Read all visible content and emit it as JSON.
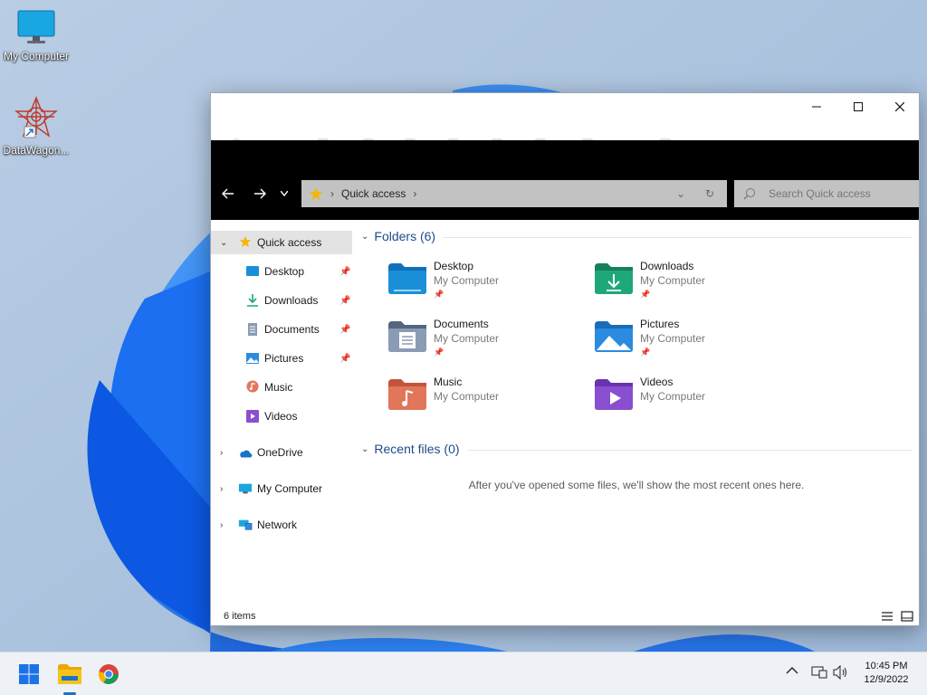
{
  "desktop": {
    "icons": [
      {
        "label": "My Computer"
      },
      {
        "label": "DataWagon..."
      }
    ]
  },
  "window": {
    "title_controls": {
      "minimize": "minimize",
      "maximize": "maximize",
      "close": "close"
    },
    "address": {
      "location": "Quick access"
    },
    "search": {
      "placeholder": "Search Quick access"
    }
  },
  "sidebar": {
    "items": [
      {
        "label": "Quick access",
        "icon": "star-icon",
        "selected": true
      },
      {
        "label": "Desktop",
        "icon": "desktop-folder-icon",
        "pinned": true
      },
      {
        "label": "Downloads",
        "icon": "downloads-icon",
        "pinned": true
      },
      {
        "label": "Documents",
        "icon": "documents-icon",
        "pinned": true
      },
      {
        "label": "Pictures",
        "icon": "pictures-icon",
        "pinned": true
      },
      {
        "label": "Music",
        "icon": "music-icon"
      },
      {
        "label": "Videos",
        "icon": "videos-icon"
      },
      {
        "label": "OneDrive",
        "icon": "onedrive-icon"
      },
      {
        "label": "My Computer",
        "icon": "computer-icon"
      },
      {
        "label": "Network",
        "icon": "network-icon"
      }
    ]
  },
  "content": {
    "folders_header": "Folders (6)",
    "folders": [
      {
        "name": "Desktop",
        "location": "My Computer",
        "pinned": true,
        "color": "#1a8fd8"
      },
      {
        "name": "Downloads",
        "location": "My Computer",
        "pinned": true,
        "color": "#1ea87a"
      },
      {
        "name": "Documents",
        "location": "My Computer",
        "pinned": true,
        "color": "#6d7f9a"
      },
      {
        "name": "Pictures",
        "location": "My Computer",
        "pinned": true,
        "color": "#2a8be0"
      },
      {
        "name": "Music",
        "location": "My Computer",
        "pinned": false,
        "color": "#e2765a"
      },
      {
        "name": "Videos",
        "location": "My Computer",
        "pinned": false,
        "color": "#8a4fd0"
      }
    ],
    "recent_header": "Recent files (0)",
    "recent_empty": "After you've opened some files, we'll show the most recent ones here."
  },
  "statusbar": {
    "count": "6 items"
  },
  "taskbar": {
    "time": "10:45 PM",
    "date": "12/9/2022"
  },
  "colors": {
    "accent": "#1f4a8a",
    "taskbar_accent": "#1a73c7"
  }
}
